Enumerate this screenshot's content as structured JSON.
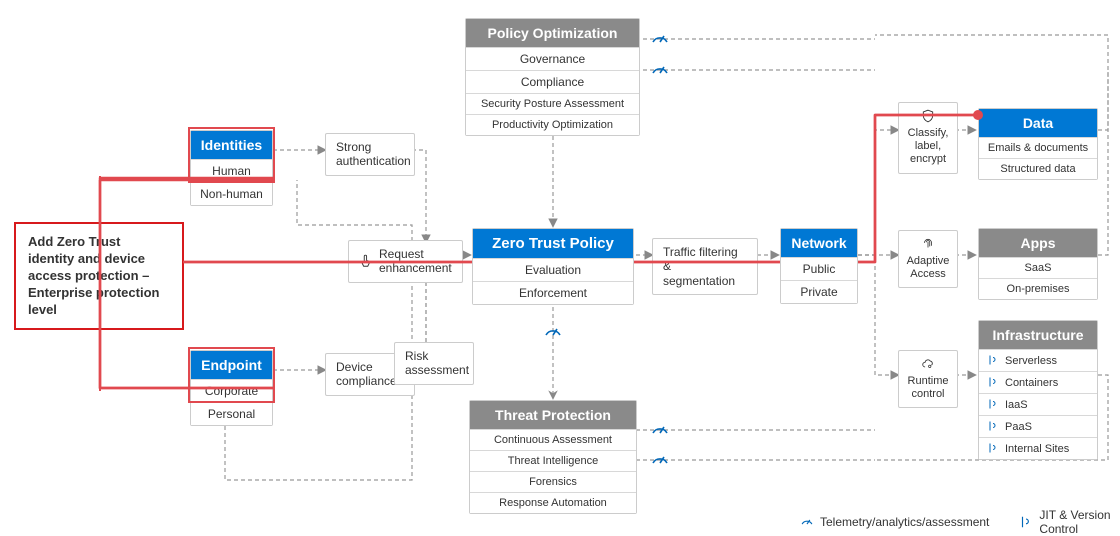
{
  "callout": "Add Zero Trust identity and device access protection – Enterprise protection level",
  "identities": {
    "title": "Identities",
    "row1": "Human",
    "row2": "Non-human"
  },
  "endpoint": {
    "title": "Endpoint",
    "row1": "Corporate",
    "row2": "Personal"
  },
  "policyOpt": {
    "title": "Policy Optimization",
    "row1": "Governance",
    "row2": "Compliance",
    "row3": "Security Posture Assessment",
    "row4": "Productivity Optimization"
  },
  "ztp": {
    "title": "Zero Trust Policy",
    "row1": "Evaluation",
    "row2": "Enforcement"
  },
  "threat": {
    "title": "Threat Protection",
    "row1": "Continuous Assessment",
    "row2": "Threat Intelligence",
    "row3": "Forensics",
    "row4": "Response Automation"
  },
  "network": {
    "title": "Network",
    "row1": "Public",
    "row2": "Private"
  },
  "data": {
    "title": "Data",
    "row1": "Emails & documents",
    "row2": "Structured data"
  },
  "apps": {
    "title": "Apps",
    "row1": "SaaS",
    "row2": "On-premises"
  },
  "infra": {
    "title": "Infrastructure",
    "row1": "Serverless",
    "row2": "Containers",
    "row3": "IaaS",
    "row4": "PaaS",
    "row5": "Internal Sites"
  },
  "labels": {
    "strongAuth": "Strong\nauthentication",
    "deviceComp": "Device\ncompliance",
    "reqEnh": "Request\nenhancement",
    "riskAssess": "Risk\nassessment",
    "traffic": "Traffic filtering &\nsegmentation",
    "classify": "Classify,\nlabel,\nencrypt",
    "adaptive": "Adaptive\nAccess",
    "runtime": "Runtime\ncontrol"
  },
  "legend": {
    "telemetry": "Telemetry/analytics/assessment",
    "jit": "JIT & Version Control"
  }
}
